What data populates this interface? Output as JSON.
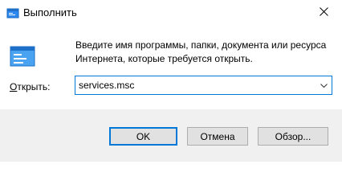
{
  "window": {
    "title": "Выполнить",
    "icon": "run-icon",
    "close_icon": "close-icon"
  },
  "main": {
    "description": "Введите имя программы, папки, документа или ресурса Интернета, которые требуется открыть.",
    "open_label_prefix": "О",
    "open_label_rest": "ткрыть:",
    "input_value": "services.msc",
    "accent_color": "#0078d7"
  },
  "buttons": {
    "ok": "OK",
    "cancel": "Отмена",
    "browse": "Обзор..."
  }
}
